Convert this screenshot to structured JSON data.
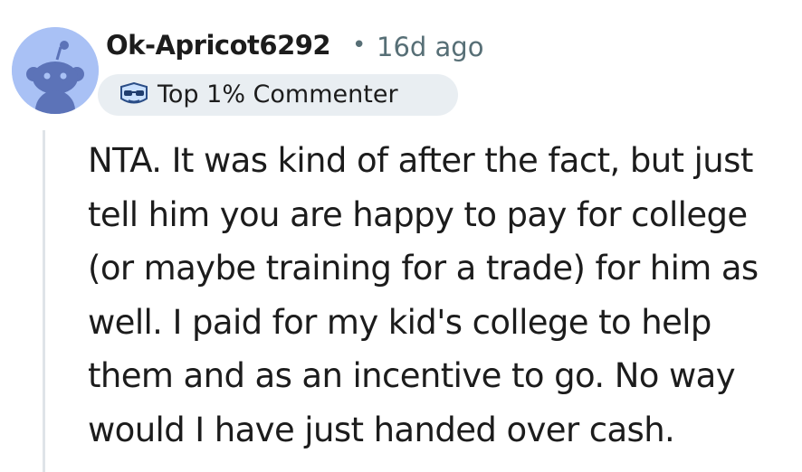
{
  "comment": {
    "author": "Ok-Apricot6292",
    "separator": "•",
    "age": "16d ago",
    "avatar_icon": "reddit-snoo-avatar-icon",
    "badge": {
      "icon": "sunglasses-trophy-icon",
      "label": "Top 1% Commenter"
    },
    "body_lines": [
      "NTA. It was kind of after the fact, but just",
      "tell him you are happy to pay for college",
      "(or maybe training for a trade) for him as",
      "well. I paid for my kid's college to help",
      "them and as an incentive to go. No way",
      "would I have just handed over cash."
    ]
  },
  "colors": {
    "avatar_bg": "#a9c1f5",
    "avatar_snoo": "#5c73b8",
    "text": "#1c1c1c",
    "meta_text": "#576f76",
    "badge_bg": "#e9eef2",
    "thread_line": "#dfe4e8"
  }
}
